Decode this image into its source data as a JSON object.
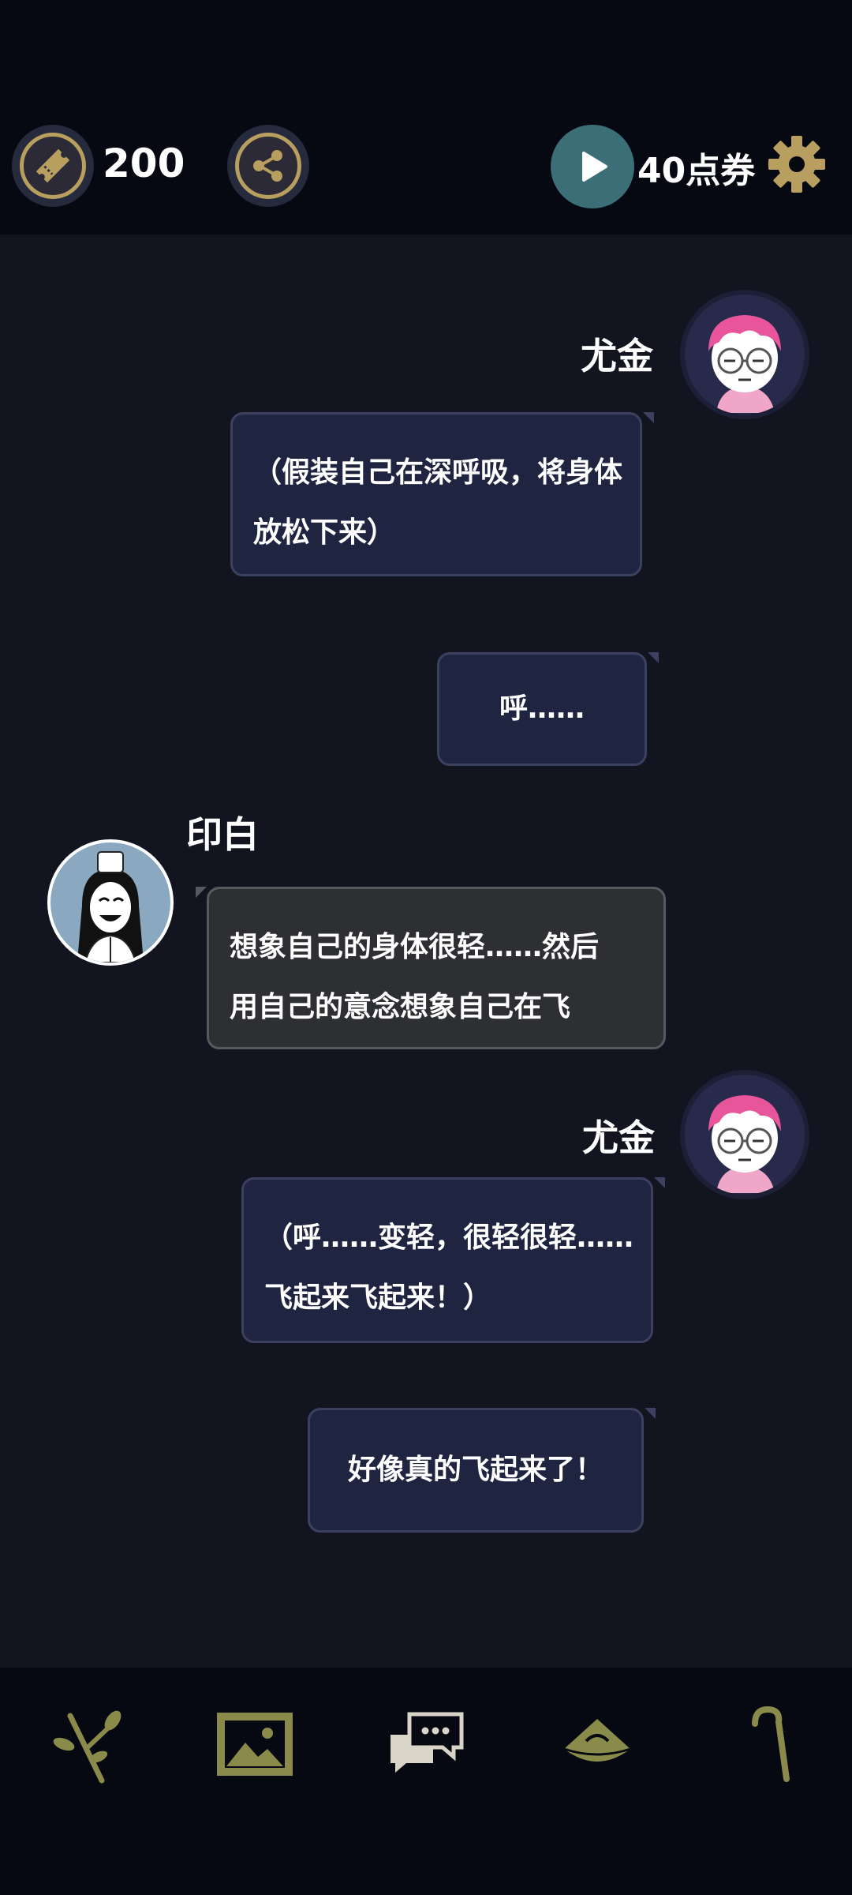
{
  "header": {
    "ticket_count": "200",
    "voucher_label": "40点券",
    "icons": {
      "ticket": "ticket-icon",
      "share": "share-icon",
      "play": "play-icon",
      "settings": "gear-icon"
    }
  },
  "chat": {
    "messages": [
      {
        "speaker": "尤金",
        "lines": [
          "（假装自己在深呼吸，将身体",
          "放松下来）"
        ]
      },
      {
        "lines": [
          "呼……"
        ]
      },
      {
        "speaker": "印白",
        "lines": [
          "想象自己的身体很轻……然后",
          "用自己的意念想象自己在飞"
        ]
      },
      {
        "speaker": "尤金",
        "lines": [
          "（呼……变轻，很轻很轻……",
          "飞起来飞起来！）"
        ]
      },
      {
        "lines": [
          "好像真的飞起来了！"
        ]
      }
    ]
  },
  "bottom_nav": {
    "items": [
      {
        "icon": "branch-icon"
      },
      {
        "icon": "gallery-icon"
      },
      {
        "icon": "chat-icon"
      },
      {
        "icon": "hat-icon"
      },
      {
        "icon": "cane-icon"
      }
    ]
  },
  "colors": {
    "background": "#121420",
    "bar": "#070912",
    "accent_gold": "#b89f5f",
    "bubble_blue": "#1f2441",
    "bubble_dark": "#2e2f33",
    "play_teal": "#3c6e78"
  }
}
